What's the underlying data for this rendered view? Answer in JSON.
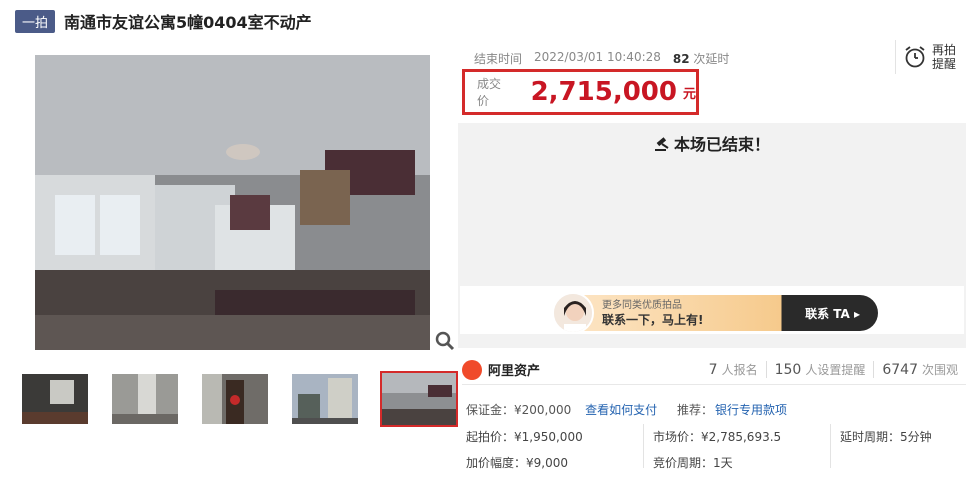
{
  "header": {
    "tag": "一拍",
    "title": "南通市友谊公寓5幢0404室不动产"
  },
  "auction": {
    "end_label": "结束时间",
    "end_time": "2022/03/01 10:40:28",
    "delay_count": "82",
    "delay_label": "次延时",
    "remind_text": "再拍提醒",
    "price_label": "成交价",
    "price": "2,715,000",
    "price_unit": "元",
    "ended_text": "本场已结束！"
  },
  "banner": {
    "small": "更多同类优质拍品",
    "big": "联系一下，马上有!",
    "button": "联系 TA ▸"
  },
  "stats": {
    "brand": "阿里资产",
    "signup_count": "7",
    "signup_label": "人报名",
    "remind_count": "150",
    "remind_label": "人设置提醒",
    "view_count": "6747",
    "view_label": "次围观"
  },
  "details": {
    "deposit": "保证金：¥200,000",
    "deposit_link": "查看如何支付",
    "recommend_label": "推荐：",
    "recommend_link": "银行专用款项",
    "start_price": "起拍价：¥1,950,000",
    "market_price": "市场价：¥2,785,693.5",
    "delay_period": "延时周期：5分钟",
    "increment": "加价幅度：¥9,000",
    "bid_period": "竞价周期：1天"
  }
}
